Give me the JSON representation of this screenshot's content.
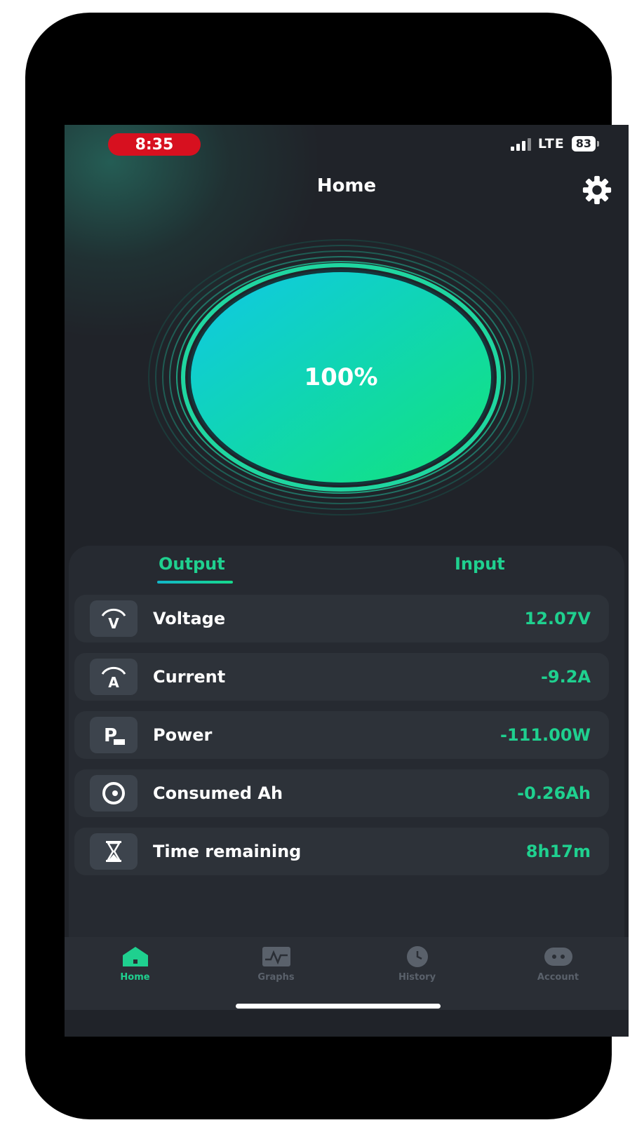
{
  "status_bar": {
    "time": "8:35",
    "network": "LTE",
    "battery": "83"
  },
  "header": {
    "title": "Home"
  },
  "gauge": {
    "label": "100%",
    "level": 1.0
  },
  "tabs": [
    {
      "label": "Output",
      "active": true
    },
    {
      "label": "Input",
      "active": false
    }
  ],
  "metrics": [
    {
      "icon": "voltage-icon",
      "label": "Voltage",
      "value": "12.07V"
    },
    {
      "icon": "current-icon",
      "label": "Current",
      "value": "-9.2A"
    },
    {
      "icon": "power-icon",
      "label": "Power",
      "value": "-111.00W"
    },
    {
      "icon": "consumed-ah-icon",
      "label": "Consumed Ah",
      "value": "-0.26Ah"
    },
    {
      "icon": "hourglass-icon",
      "label": "Time remaining",
      "value": "8h17m"
    }
  ],
  "nav": [
    {
      "label": "Home",
      "icon": "home-icon",
      "active": true
    },
    {
      "label": "Graphs",
      "icon": "graphs-icon",
      "active": false
    },
    {
      "label": "History",
      "icon": "history-icon",
      "active": false
    },
    {
      "label": "Account",
      "icon": "account-icon",
      "active": false
    }
  ],
  "colors": {
    "accent": "#1fd08f",
    "background": "#202329",
    "status_pill": "#d7101f"
  }
}
